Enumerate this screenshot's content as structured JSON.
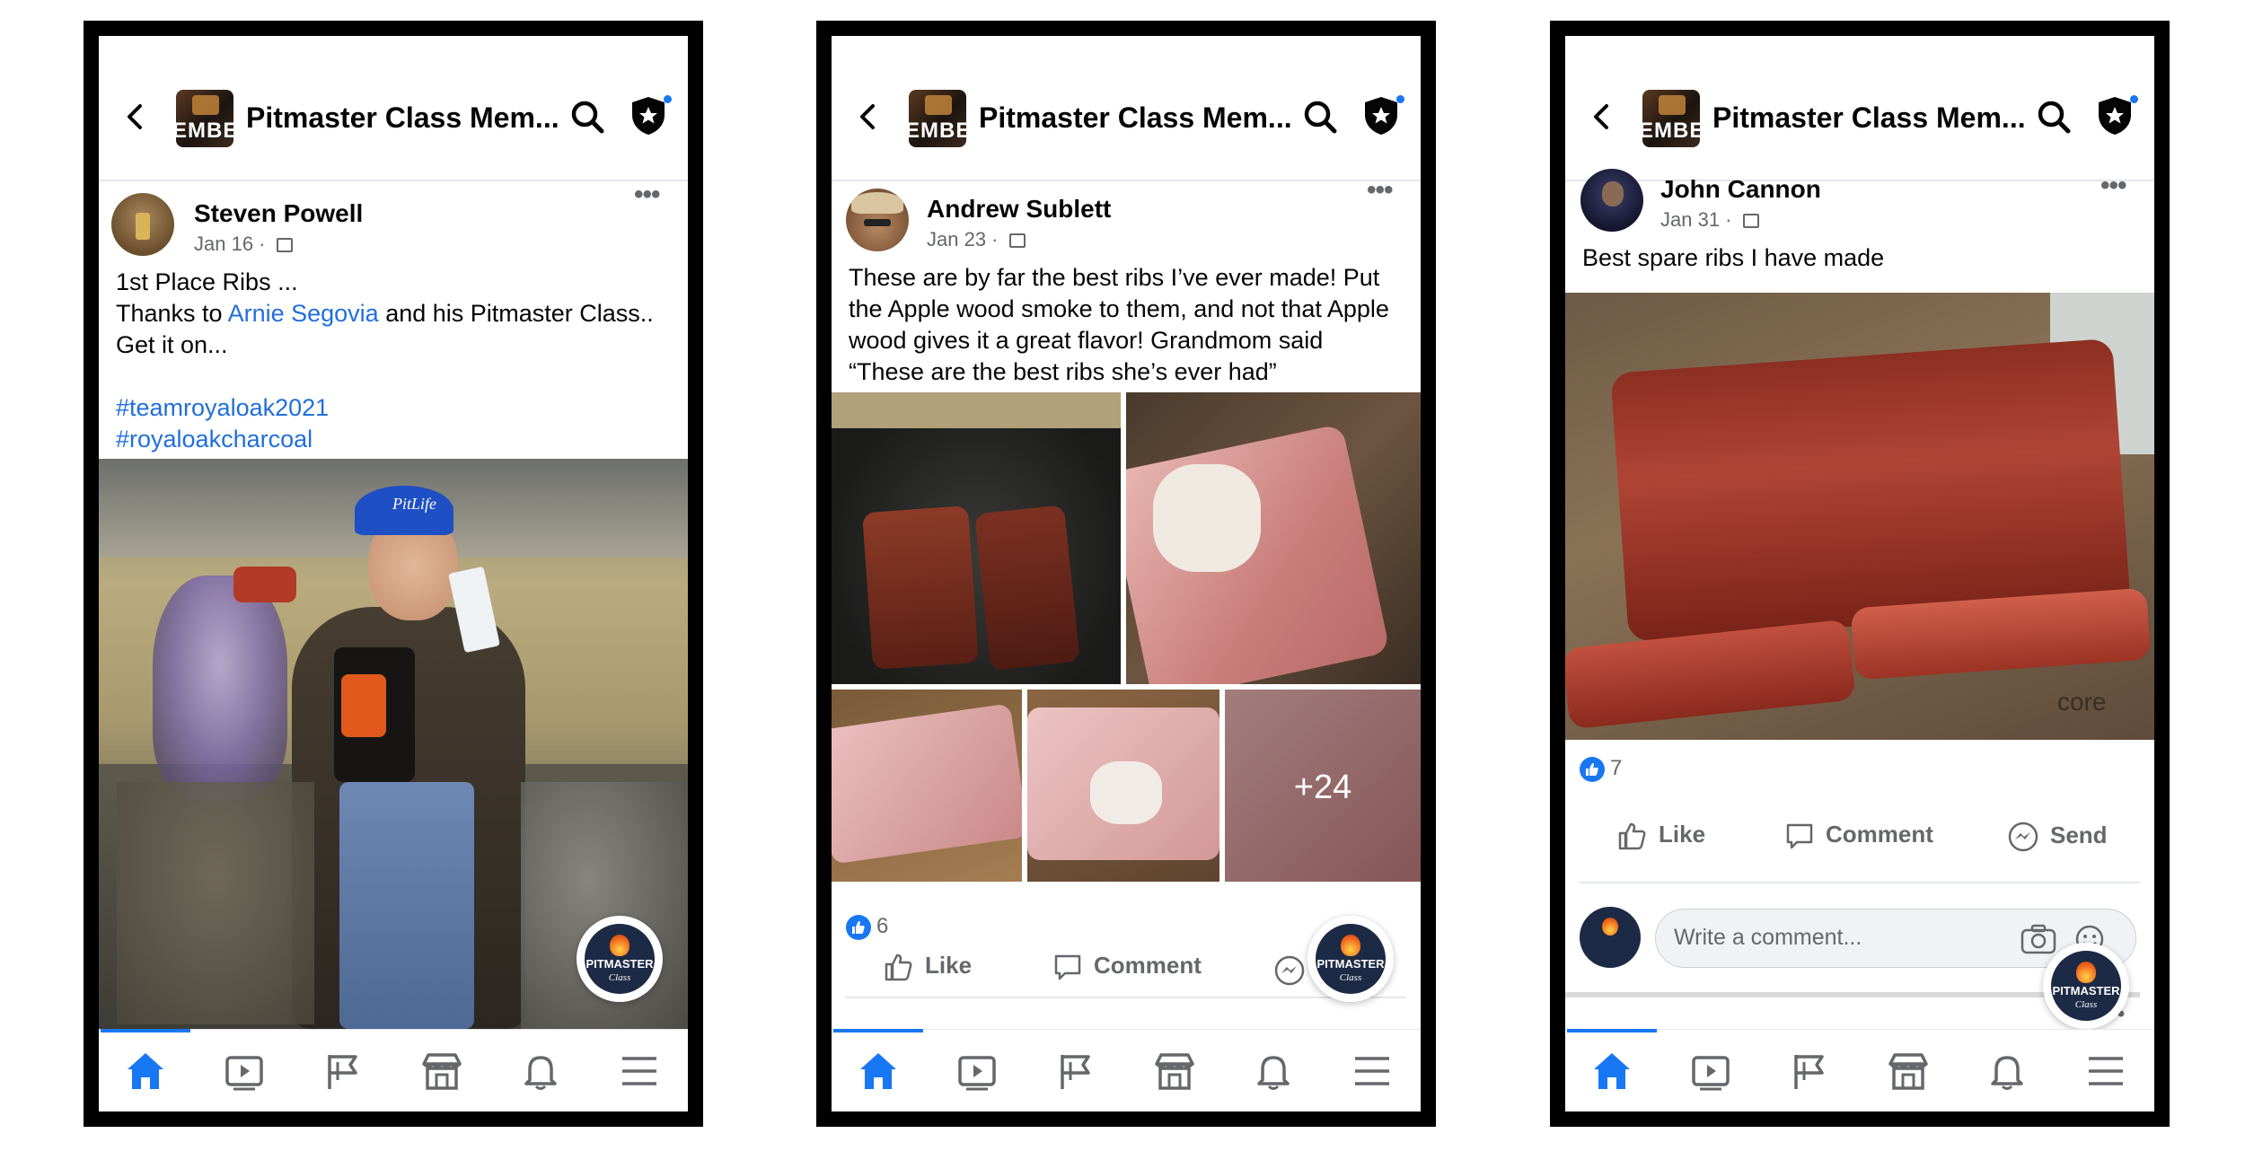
{
  "colors": {
    "brand_blue": "#1877f2",
    "link": "#216fdb",
    "frame": "#000000",
    "meta_gray": "#65676b"
  },
  "phones": [
    {
      "header": {
        "group_name": "Pitmaster Class Mem...",
        "icon_text": "EMBER"
      },
      "post": {
        "author": "Steven Powell",
        "date": "Jan 16",
        "text_lines": [
          "1st Place Ribs ..."
        ],
        "thanks_prefix": "Thanks to ",
        "mention": "Arnie Segovia",
        "thanks_suffix": " and his Pitmaster Class..",
        "line3": "Get it on...",
        "hashtags": [
          "#teamroyaloak2021",
          "#royaloakcharcoal"
        ],
        "photo_cap_text": "PitLife"
      },
      "logo": {
        "title": "PITMASTER",
        "sub": "Class"
      }
    },
    {
      "header": {
        "group_name": "Pitmaster Class Mem...",
        "icon_text": "EMBER"
      },
      "post": {
        "author": "Andrew Sublett",
        "date": "Jan 23",
        "text_lines": [
          "These are by far the best ribs I’ve ever made! Put",
          "the Apple wood smoke to them, and not that Apple",
          "wood gives it a great flavor! Grandmom said",
          "“These are the best ribs she’s ever had”"
        ],
        "more_photos": "+24",
        "like_count": "6",
        "actions": {
          "like": "Like",
          "comment": "Comment"
        }
      },
      "logo": {
        "title": "PITMASTER",
        "sub": "Class"
      }
    },
    {
      "header": {
        "group_name": "Pitmaster Class Mem...",
        "icon_text": "EMBER"
      },
      "post": {
        "author": "John Cannon",
        "date": "Jan 31",
        "text_lines": [
          "Best spare ribs I have made"
        ],
        "board_brand": "core",
        "like_count": "7",
        "actions": {
          "like": "Like",
          "comment": "Comment",
          "send": "Send"
        },
        "comment_placeholder": "Write a comment..."
      },
      "logo": {
        "title": "PITMASTER",
        "sub": "Class"
      }
    }
  ],
  "tabbar_icons": [
    "home-icon",
    "video-icon",
    "pages-flag-icon",
    "marketplace-icon",
    "notifications-bell-icon",
    "menu-icon"
  ]
}
